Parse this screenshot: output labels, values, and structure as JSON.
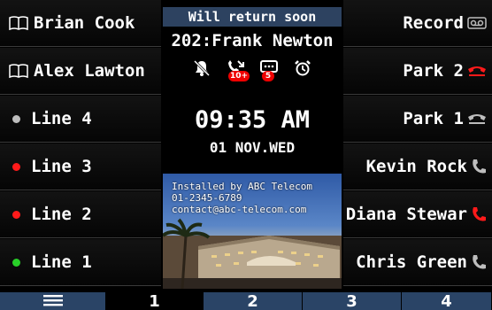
{
  "center": {
    "status_banner": "Will return soon",
    "extension_title": "202:Frank Newton",
    "notifications": [
      {
        "icon": "dnd-bell-off-icon",
        "badge": ""
      },
      {
        "icon": "missed-call-icon",
        "badge": "10+"
      },
      {
        "icon": "voicemail-message-icon",
        "badge": "5"
      },
      {
        "icon": "alarm-clock-icon",
        "badge": ""
      }
    ],
    "time": "09:35 AM",
    "date": "01 NOV.WED",
    "ad": {
      "line1": "Installed by ABC Telecom",
      "line2": "01-2345-6789",
      "line3": "contact@abc-telecom.com"
    }
  },
  "left_keys": [
    {
      "label": "Brian Cook",
      "icon": "phonebook-icon"
    },
    {
      "label": "Alex Lawton",
      "icon": "phonebook-icon"
    },
    {
      "label": "Line 4",
      "icon": "line-status-dot-icon",
      "color": "#bdbdbd"
    },
    {
      "label": "Line 3",
      "icon": "line-status-dot-icon",
      "color": "#ff1a1a"
    },
    {
      "label": "Line 2",
      "icon": "line-status-dot-icon",
      "color": "#ff1a1a"
    },
    {
      "label": "Line 1",
      "icon": "line-status-dot-icon",
      "color": "#28d028"
    }
  ],
  "right_keys": [
    {
      "label": "Record",
      "icon": "voicemail-tape-icon",
      "color": "#bdbdbd"
    },
    {
      "label": "Park 2",
      "icon": "handset-hold-icon",
      "color": "#ff1a1a"
    },
    {
      "label": "Park 1",
      "icon": "handset-hold-icon",
      "color": "#bdbdbd"
    },
    {
      "label": "Kevin Rock",
      "icon": "handset-icon",
      "color": "#bdbdbd"
    },
    {
      "label": "Diana Stewar",
      "icon": "handset-icon",
      "color": "#ff1a1a"
    },
    {
      "label": "Chris Green",
      "icon": "handset-icon",
      "color": "#bdbdbd"
    }
  ],
  "bottom_tabs": [
    {
      "label": "",
      "icon": "menu-hamburger-icon"
    },
    {
      "label": "1"
    },
    {
      "label": "2"
    },
    {
      "label": "3"
    },
    {
      "label": "4"
    }
  ]
}
